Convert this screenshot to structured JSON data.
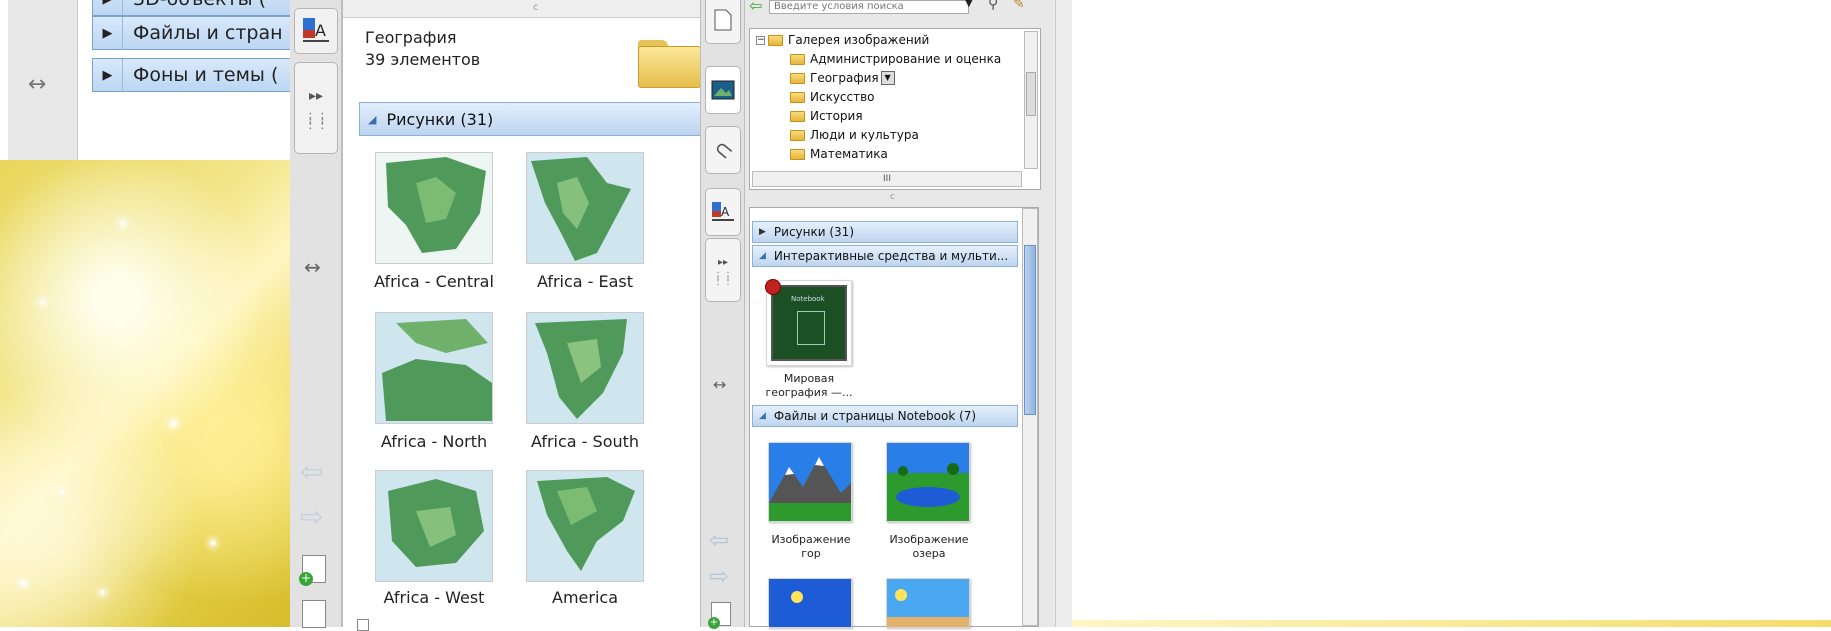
{
  "old_panel": {
    "rows": [
      "3D-объекты (",
      "Файлы и стран",
      "Фоны и темы ("
    ]
  },
  "gallery_main": {
    "folder_name": "География",
    "item_count": "39 элементов",
    "section_label": "Рисунки (31)",
    "items": [
      {
        "caption": "Africa - Central"
      },
      {
        "caption": "Africa - East"
      },
      {
        "caption": "Africa - North"
      },
      {
        "caption": "Africa - South"
      },
      {
        "caption": "Africa - West"
      },
      {
        "caption": "America"
      }
    ]
  },
  "gallery_side": {
    "search_placeholder": "Введите условия поиска",
    "tree": {
      "root": "Галерея изображений",
      "items": [
        "Администрирование и оценка",
        "География",
        "Искусство",
        "История",
        "Люди и культура",
        "Математика"
      ],
      "scroll_label": "III"
    },
    "sections": [
      {
        "label": "Рисунки (31)",
        "expanded": false
      },
      {
        "label": "Интерактивные средства и мульти...",
        "expanded": true
      },
      {
        "label": "Файлы и страницы Notebook (7)",
        "expanded": true
      }
    ],
    "interactive_item": {
      "caption_line1": "Мировая",
      "caption_line2": "география —...",
      "thumb_title": "Notebook"
    },
    "notebook_items": [
      {
        "caption_line1": "Изображение",
        "caption_line2": "гор"
      },
      {
        "caption_line1": "Изображение",
        "caption_line2": "озера"
      }
    ]
  },
  "colors": {
    "header_blue": "#bcd4f0",
    "folder_yellow": "#e8b43a",
    "map_green": "#4f9a5a",
    "map_water": "#cfe6ef"
  }
}
